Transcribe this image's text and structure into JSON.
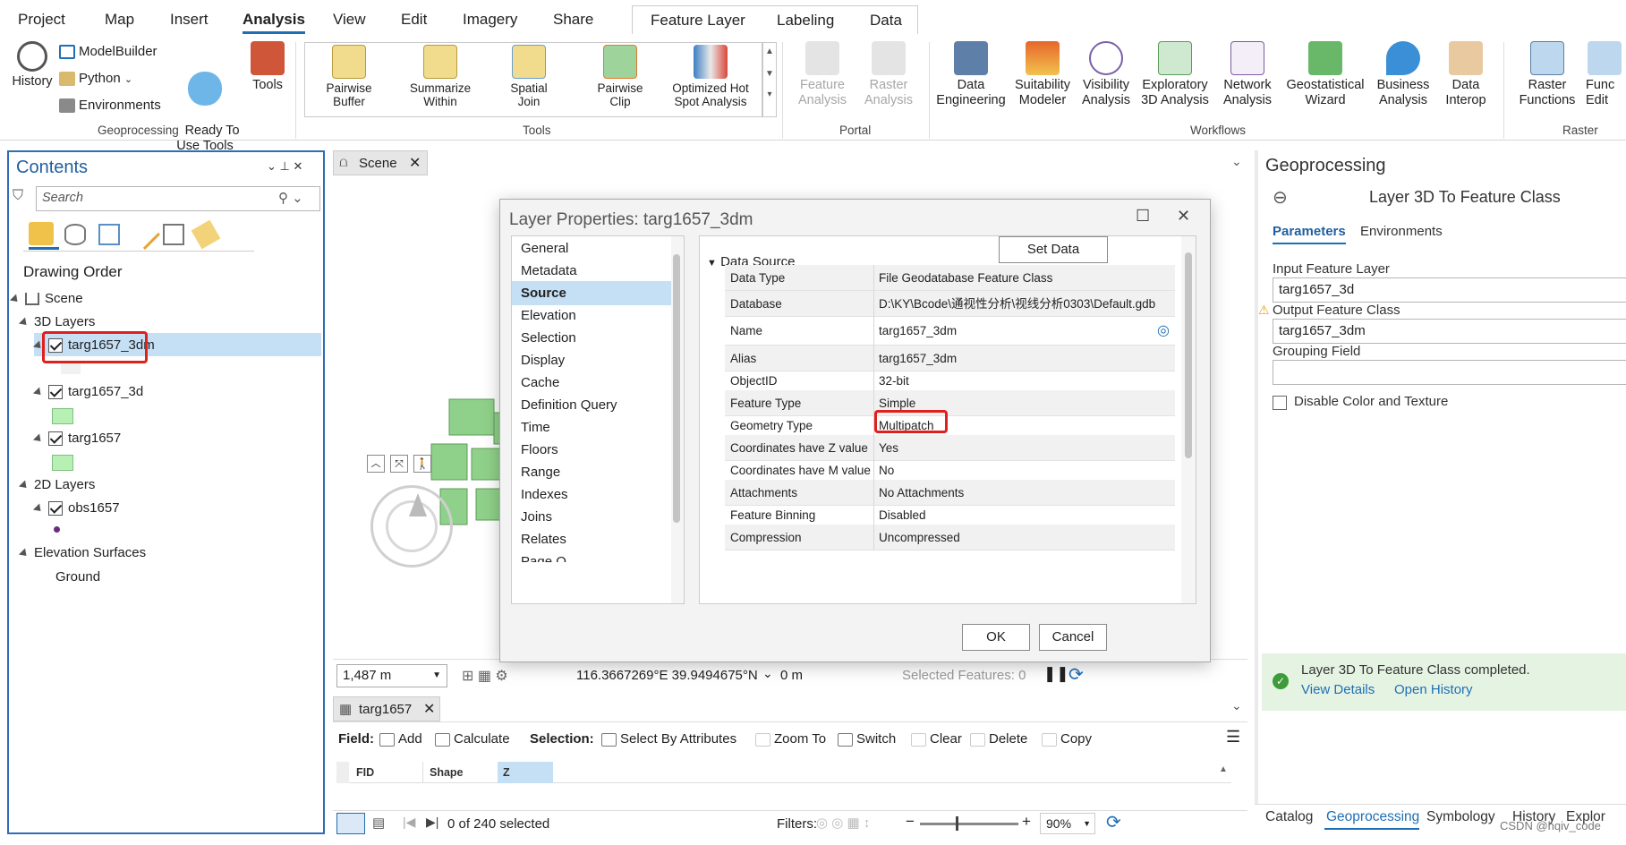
{
  "ribbon": {
    "tabs": [
      "Project",
      "Map",
      "Insert",
      "Analysis",
      "View",
      "Edit",
      "Imagery",
      "Share"
    ],
    "active_tab": "Analysis",
    "contextual_tabs": [
      "Feature Layer",
      "Labeling",
      "Data"
    ],
    "geoprocessing": {
      "history": "History",
      "modelbuilder": "ModelBuilder",
      "python": "Python",
      "environments": "Environments",
      "ready_to_use": "Ready To\nUse Tools",
      "tools": "Tools",
      "group": "Geoprocessing"
    },
    "tools_gallery": {
      "items": [
        "Pairwise\nBuffer",
        "Summarize\nWithin",
        "Spatial\nJoin",
        "Pairwise\nClip",
        "Optimized Hot\nSpot Analysis"
      ],
      "group": "Tools"
    },
    "portal": {
      "items": [
        "Feature\nAnalysis",
        "Raster\nAnalysis"
      ],
      "group": "Portal"
    },
    "workflows": {
      "items": [
        "Data\nEngineering",
        "Suitability\nModeler",
        "Visibility\nAnalysis",
        "Exploratory\n3D Analysis",
        "Network\nAnalysis",
        "Geostatistical\nWizard",
        "Business\nAnalysis",
        "Data\nInterop"
      ],
      "group": "Workflows"
    },
    "raster": {
      "items": [
        "Raster\nFunctions",
        "Func\nEdit"
      ],
      "group": "Raster"
    }
  },
  "contents": {
    "title": "Contents",
    "search_placeholder": "Search",
    "drawing_order": "Drawing Order",
    "scene": "Scene",
    "layers_3d": "3D Layers",
    "layer_a": "targ1657_3dm",
    "layer_b": "targ1657_3d",
    "layer_c": "targ1657",
    "layers_2d": "2D Layers",
    "layer_d": "obs1657",
    "elevation": "Elevation Surfaces",
    "ground": "Ground"
  },
  "scene": {
    "tab": "Scene",
    "scale": "1,487 m",
    "coords": "116.3667269°E 39.9494675°N",
    "elev": "0 m",
    "selected": "Selected Features: 0"
  },
  "dialog": {
    "title": "Layer Properties: targ1657_3dm",
    "nav": [
      "General",
      "Metadata",
      "Source",
      "Elevation",
      "Selection",
      "Display",
      "Cache",
      "Definition Query",
      "Time",
      "Floors",
      "Range",
      "Indexes",
      "Joins",
      "Relates",
      "Page Q"
    ],
    "selected_nav": "Source",
    "section": "Data Source",
    "set_source": "Set Data Source...",
    "rows": [
      {
        "k": "Data Type",
        "v": "File Geodatabase Feature Class"
      },
      {
        "k": "Database",
        "v": "D:\\KY\\Bcode\\通视性分析\\视线分析0303\\Default.gdb"
      },
      {
        "k": "Name",
        "v": "targ1657_3dm"
      },
      {
        "k": "Alias",
        "v": "targ1657_3dm"
      },
      {
        "k": "ObjectID",
        "v": "32-bit"
      },
      {
        "k": "Feature Type",
        "v": "Simple"
      },
      {
        "k": "Geometry Type",
        "v": "Multipatch"
      },
      {
        "k": "Coordinates have Z value",
        "v": "Yes"
      },
      {
        "k": "Coordinates have M value",
        "v": "No"
      },
      {
        "k": "Attachments",
        "v": "No Attachments"
      },
      {
        "k": "Feature Binning",
        "v": "Disabled"
      },
      {
        "k": "Compression",
        "v": "Uncompressed"
      }
    ],
    "ok": "OK",
    "cancel": "Cancel"
  },
  "attr": {
    "tab": "targ1657",
    "field_label": "Field:",
    "add": "Add",
    "calculate": "Calculate",
    "selection_label": "Selection:",
    "select_by_attr": "Select By Attributes",
    "zoom_to": "Zoom To",
    "switch": "Switch",
    "clear": "Clear",
    "delete": "Delete",
    "copy": "Copy",
    "columns": [
      "FID",
      "Shape",
      "Z"
    ],
    "selected_count": "0 of 240 selected",
    "filters": "Filters:",
    "zoom": "90%"
  },
  "gp": {
    "title": "Geoprocessing",
    "tool": "Layer 3D To Feature Class",
    "tab_params": "Parameters",
    "tab_env": "Environments",
    "input_label": "Input Feature Layer",
    "input_value": "targ1657_3d",
    "output_label": "Output Feature Class",
    "output_value": "targ1657_3dm",
    "group_label": "Grouping Field",
    "group_value": "",
    "disable_label": "Disable Color and Texture",
    "status": "Layer 3D To Feature Class completed.",
    "view_details": "View Details",
    "open_history": "Open History",
    "bottom_tabs": [
      "Catalog",
      "Geoprocessing",
      "Symbology",
      "History",
      "Explor"
    ],
    "watermark": "CSDN @hqiv_code"
  },
  "colors": {
    "accent": "#1f6fb5",
    "highlight_red": "#e0201c",
    "selected_nav": "#c5dff4",
    "building": "#8fd18a"
  }
}
